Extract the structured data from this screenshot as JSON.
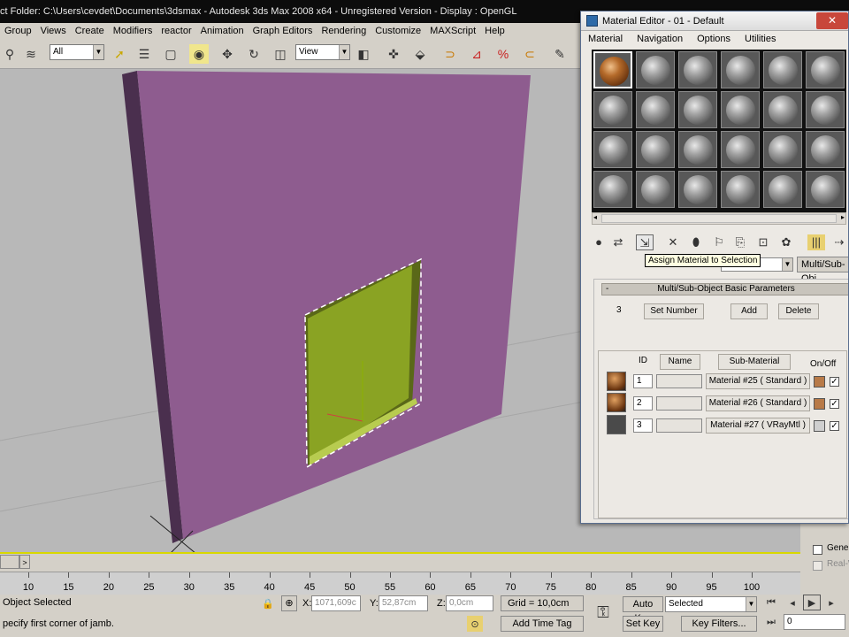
{
  "main": {
    "title": "ct Folder: C:\\Users\\cevdet\\Documents\\3dsmax     - Autodesk 3ds Max 2008 x64    - Unregistered Version    - Display : OpenGL",
    "menu": [
      "Group",
      "Views",
      "Create",
      "Modifiers",
      "reactor",
      "Animation",
      "Graph Editors",
      "Rendering",
      "Customize",
      "MAXScript",
      "Help"
    ],
    "toolbar": {
      "filter": "All",
      "ref_coord": "View"
    }
  },
  "timeline": {
    "ticks": [
      "10",
      "15",
      "20",
      "25",
      "30",
      "35",
      "40",
      "45",
      "50",
      "55",
      "60",
      "65",
      "70",
      "75",
      "80",
      "85",
      "90",
      "95",
      "100"
    ]
  },
  "status": {
    "selection": "Object Selected",
    "prompt": "pecify first corner of jamb.",
    "x_label": "X:",
    "x_value": "1071,609c",
    "y_label": "Y:",
    "y_value": "52,87cm",
    "z_label": "Z:",
    "z_value": "0,0cm",
    "grid": "Grid = 10,0cm",
    "add_time_tag": "Add Time Tag",
    "auto_key": "Auto Key",
    "set_key": "Set Key",
    "key_mode": "Selected",
    "key_filters": "Key Filters...",
    "frame": "0"
  },
  "command_panel": {
    "gener_label": "Gener",
    "realw_label": "Real-W"
  },
  "material_editor": {
    "title": "Material Editor - 01 - Default",
    "menu": [
      "Material",
      "Navigation",
      "Options",
      "Utilities"
    ],
    "tooltip": "Assign Material to Selection",
    "material_type": "Multi/Sub-Obj",
    "rollout_title": "Multi/Sub-Object Basic Parameters",
    "rollout_toggle": "-",
    "count": "3",
    "set_number": "Set Number",
    "add": "Add",
    "delete": "Delete",
    "col_id": "ID",
    "col_name": "Name",
    "col_submaterial": "Sub-Material",
    "col_onoff": "On/Off",
    "rows": [
      {
        "id": "1",
        "name": "",
        "submaterial": "Material #25  ( Standard )",
        "color": "#b87a48",
        "on": "✓"
      },
      {
        "id": "2",
        "name": "",
        "submaterial": "Material #26  ( Standard )",
        "color": "#b87a48",
        "on": "✓"
      },
      {
        "id": "3",
        "name": "",
        "submaterial": "Material #27  ( VRayMtl )",
        "color": "#cfcfcf",
        "on": "✓"
      }
    ]
  },
  "colors": {
    "wall": "#8e5c8f",
    "wall_side": "#4a2f4e",
    "floor": "#b8b8b8",
    "door": "#8aa323",
    "selection": "#d8d800"
  }
}
